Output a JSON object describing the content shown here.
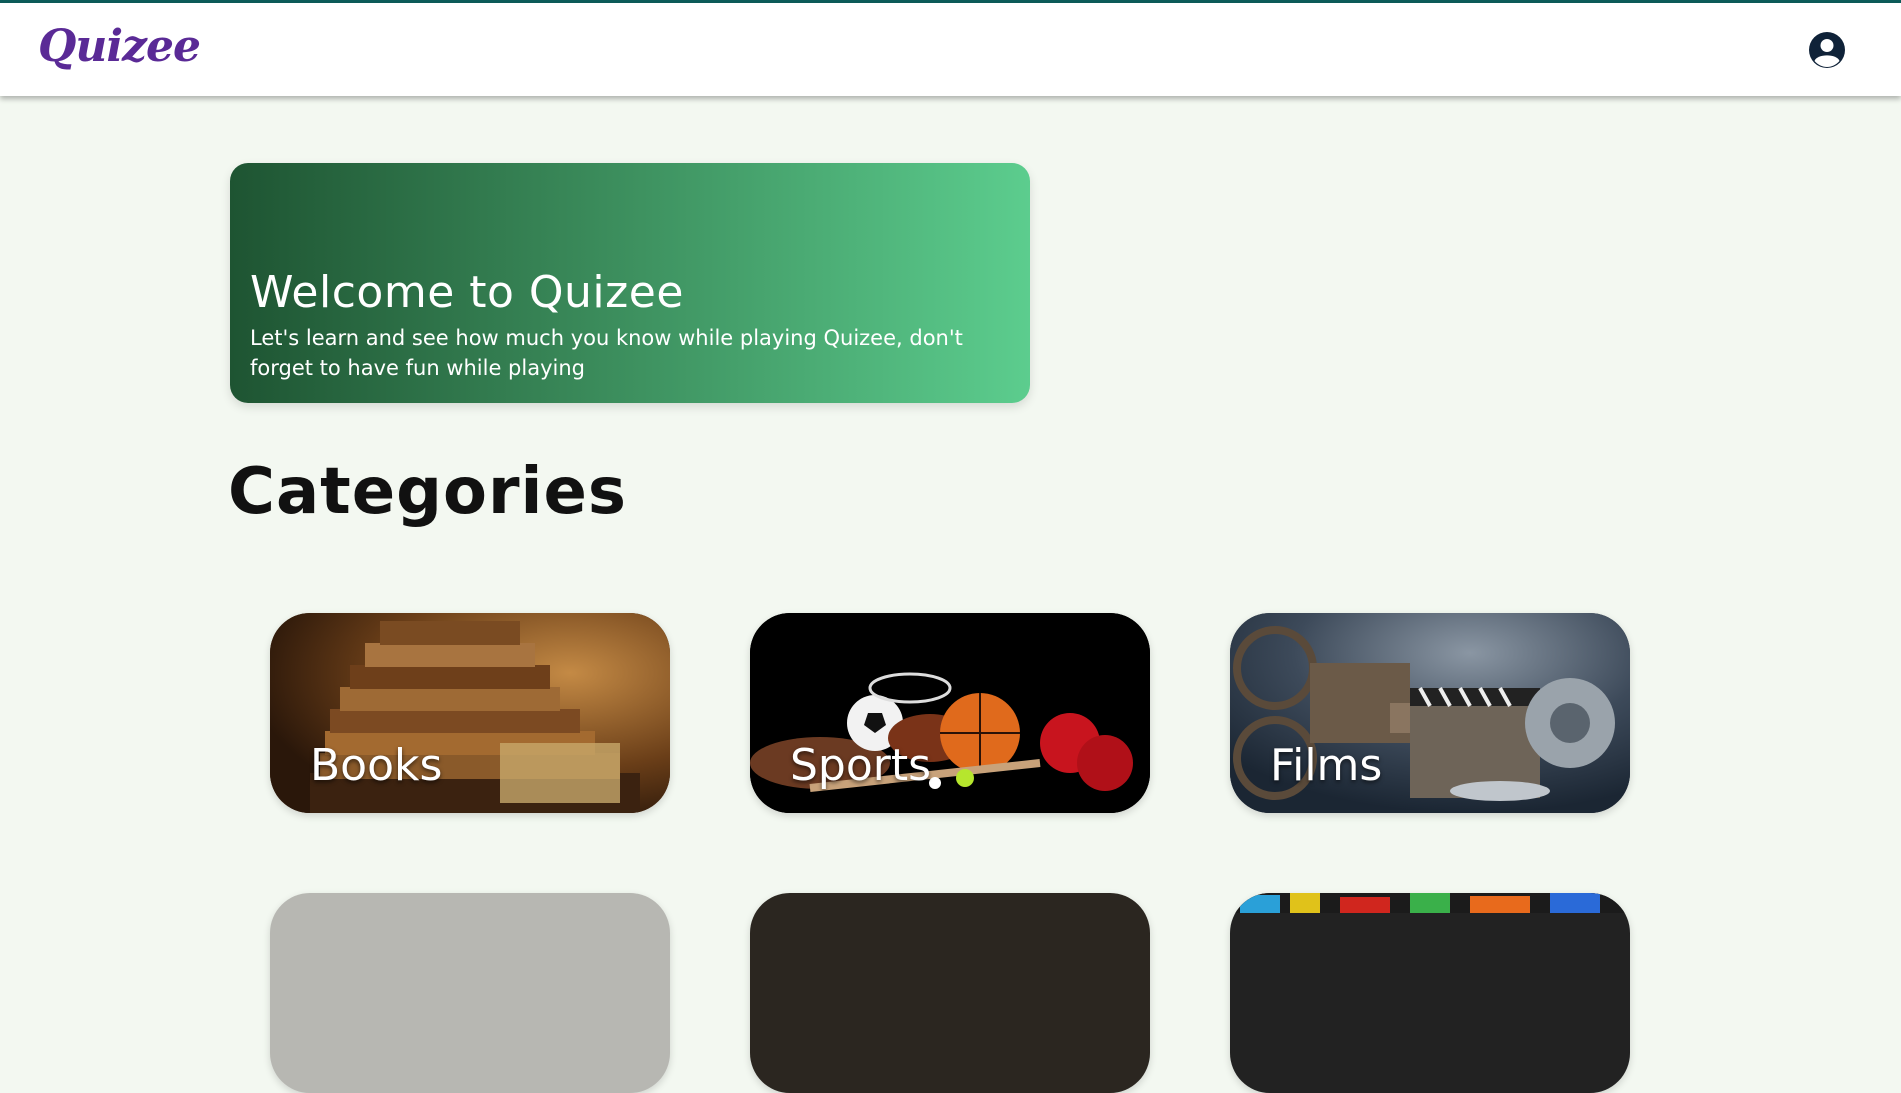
{
  "app": {
    "logo_text": "Quizee",
    "profile_icon": "user-circle-icon",
    "accent_color": "#5a2a96",
    "topline_color": "#0d5c5a"
  },
  "welcome": {
    "title": "Welcome to Quizee",
    "subtitle": "Let's learn and see how much you know while playing Quizee, don't forget to have fun while playing"
  },
  "categories": {
    "heading": "Categories",
    "items": [
      {
        "label": "Books",
        "image": "stacked-old-books"
      },
      {
        "label": "Sports",
        "image": "sports-balls-and-gear"
      },
      {
        "label": "Films",
        "image": "film-projector-and-clapperboard"
      }
    ]
  }
}
